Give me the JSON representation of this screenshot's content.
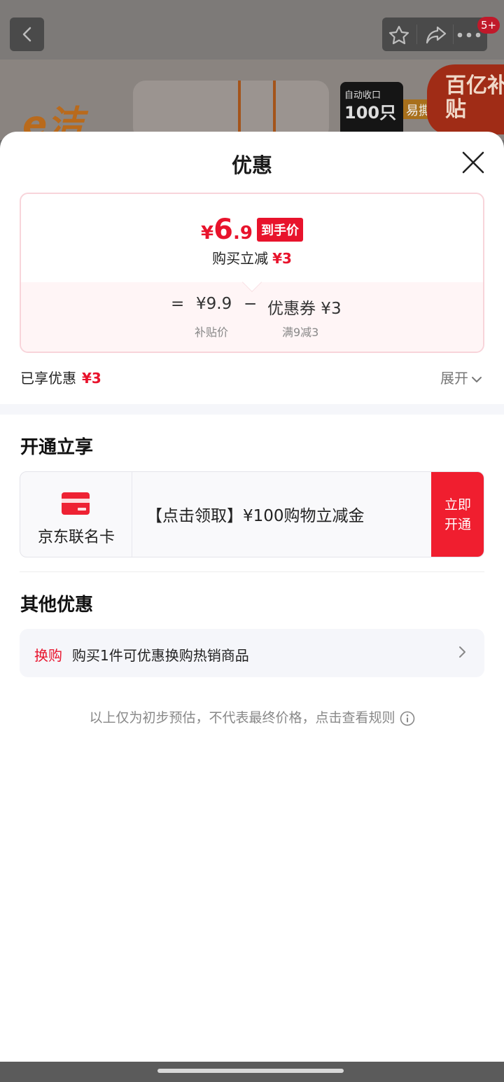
{
  "background": {
    "brand_logo": "e洁",
    "box_line1": "自动收口",
    "box_line2": "100只",
    "easy_tag": "易撕",
    "subsidy_badge": "百亿补贴",
    "notification_count": "5+"
  },
  "sheet": {
    "title": "优惠",
    "price_card": {
      "currency": "¥",
      "final_int": "6",
      "final_dec": ".9",
      "final_tag": "到手价",
      "reduce_label": "购买立减",
      "reduce_amount": "¥3",
      "equals": "=",
      "subsidy_price": "¥9.9",
      "subsidy_label": "补贴价",
      "minus": "−",
      "coupon": "优惠券 ¥3",
      "coupon_rule": "满9减3"
    },
    "enjoyed_label": "已享优惠",
    "enjoyed_amount": "¥3",
    "expand_label": "展开",
    "open_section": {
      "title": "开通立享",
      "card_name": "京东联名卡",
      "card_offer": "【点击领取】¥100购物立减金",
      "open_button": "立即\n开通"
    },
    "other_section": {
      "title": "其他优惠",
      "exchange_tag": "换购",
      "exchange_text": "购买1件可优惠换购热销商品"
    },
    "footnote": "以上仅为初步预估，不代表最终价格，点击查看规则"
  },
  "colors": {
    "accent_red": "#e8132c",
    "button_red": "#f01e2f",
    "price_card_border": "#f8d4da"
  }
}
